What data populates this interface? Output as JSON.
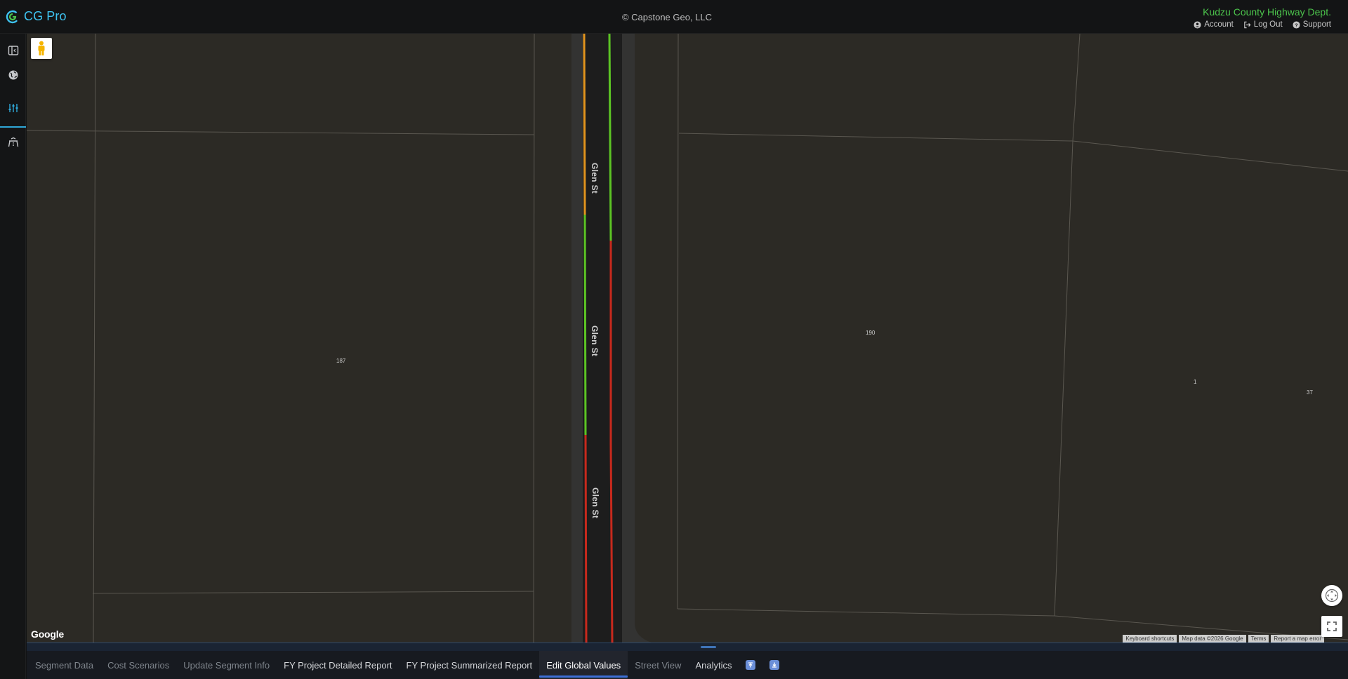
{
  "header": {
    "app_name": "CG Pro",
    "copyright": "© Capstone Geo, LLC",
    "organization": "Kudzu County Highway Dept.",
    "links": [
      {
        "label": "Account",
        "icon": "account-circle-icon"
      },
      {
        "label": "Log Out",
        "icon": "logout-icon"
      },
      {
        "label": "Support",
        "icon": "help-circle-icon"
      }
    ]
  },
  "rail": {
    "items": [
      {
        "icon": "panel-toggle-icon"
      },
      {
        "icon": "globe-icon"
      },
      {
        "icon": "sliders-icon",
        "active": true
      },
      {
        "icon": "road-icon"
      }
    ]
  },
  "map": {
    "parcels": [
      "187",
      "190",
      "1",
      "37"
    ],
    "street_labels": [
      "Glen St",
      "Glen St",
      "Glen St"
    ],
    "google_logo": "Google",
    "attribution": [
      "Keyboard shortcuts",
      "Map data ©2026 Google",
      "Terms",
      "Report a map error"
    ],
    "segment_colors": {
      "good": "#5cc424",
      "fair": "#e3951e",
      "poor": "#c7291d"
    }
  },
  "tabs": [
    {
      "label": "Segment Data",
      "enabled": false
    },
    {
      "label": "Cost Scenarios",
      "enabled": false
    },
    {
      "label": "Update Segment Info",
      "enabled": false
    },
    {
      "label": "FY Project Detailed Report",
      "enabled": true
    },
    {
      "label": "FY Project Summarized Report",
      "enabled": true
    },
    {
      "label": "Edit Global Values",
      "enabled": true,
      "active": true
    },
    {
      "label": "Street View",
      "enabled": false
    },
    {
      "label": "Analytics",
      "enabled": true
    }
  ],
  "tab_icons": [
    "expand-up-icon",
    "collapse-down-icon"
  ]
}
